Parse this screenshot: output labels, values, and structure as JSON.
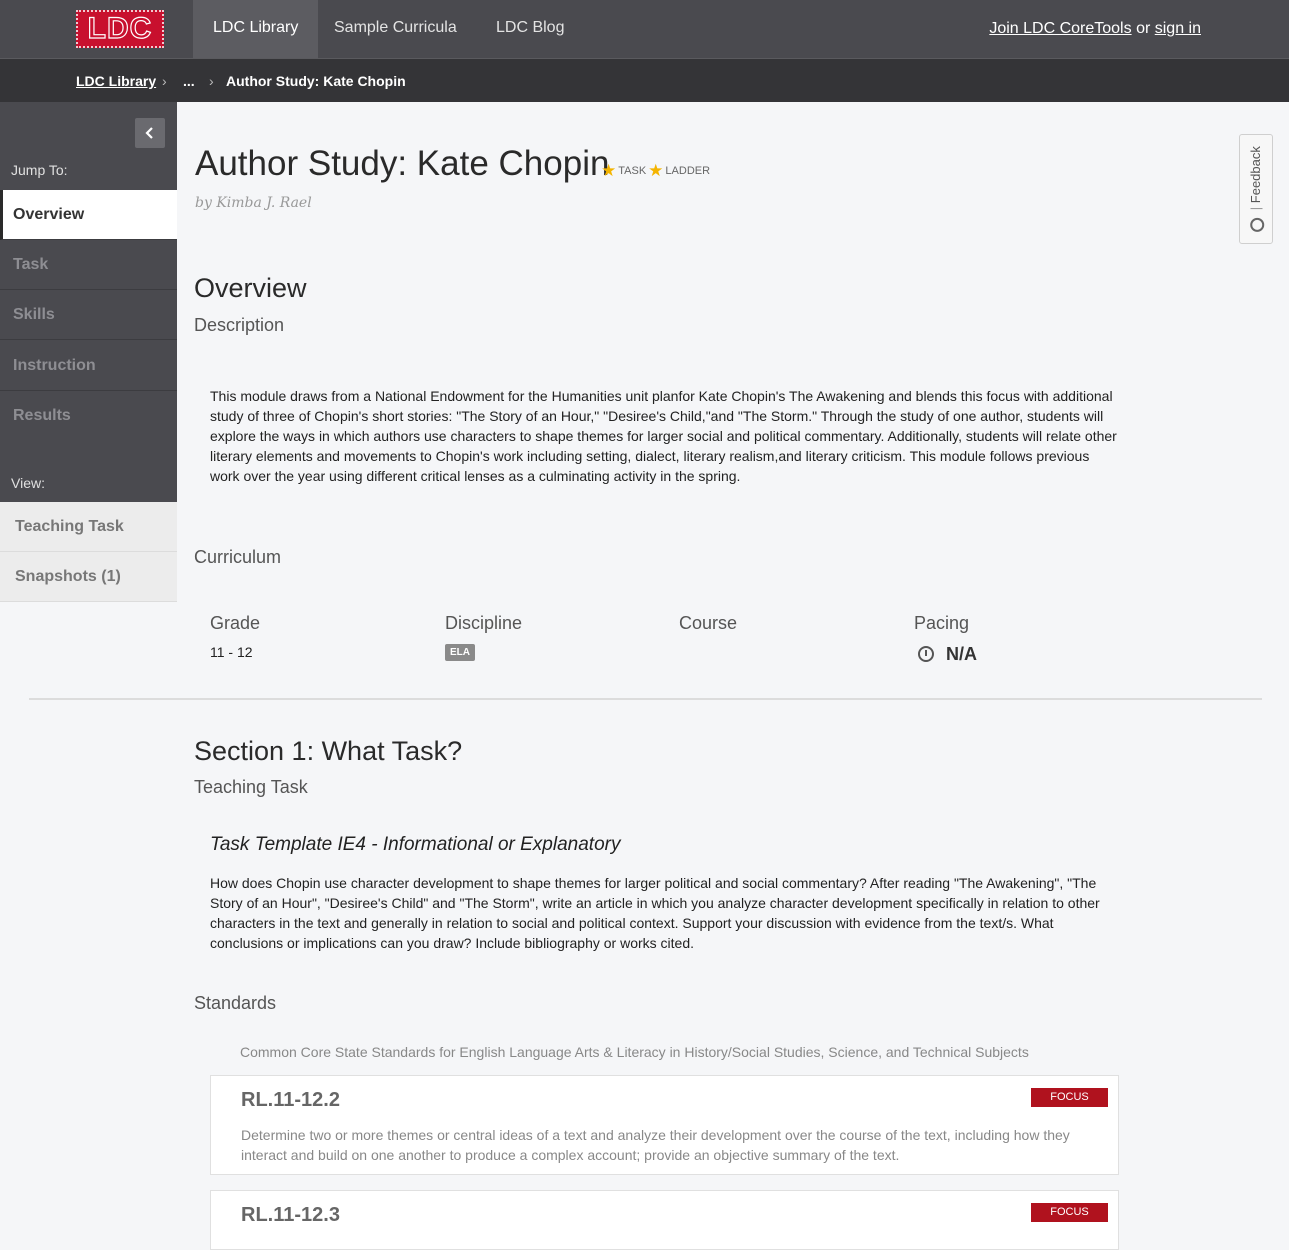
{
  "header": {
    "logo_text": "LDC",
    "nav": [
      "LDC Library",
      "Sample Curricula",
      "LDC Blog"
    ],
    "auth": {
      "join": "Join LDC CoreTools",
      "or": "or",
      "signin": "sign in"
    }
  },
  "breadcrumb": {
    "root": "LDC Library",
    "ellipsis": "...",
    "current": "Author Study: Kate Chopin",
    "sep": "›"
  },
  "sidebar": {
    "jump_label": "Jump To:",
    "items": [
      "Overview",
      "Task",
      "Skills",
      "Instruction",
      "Results"
    ],
    "view_label": "View:",
    "view_items": [
      "Teaching Task",
      "Snapshots (1)"
    ]
  },
  "feedback": {
    "label": "Feedback"
  },
  "page": {
    "title": "Author Study: Kate Chopin",
    "badges": [
      "TASK",
      "LADDER"
    ],
    "byline": "by Kimba J. Rael"
  },
  "overview": {
    "heading": "Overview",
    "description_heading": "Description",
    "description": "This module draws from a National Endowment for the Humanities unit planfor Kate Chopin's The Awakening and blends this focus with additional study of three of Chopin's short stories: \"The Story of an Hour,\" \"Desiree's Child,\"and \"The Storm.\" Through the study of one author, students will explore the ways in which authors use characters to shape themes for larger social and political commentary. Additionally, students will relate other literary elements and movements to Chopin's work including setting, dialect, literary realism,and literary criticism. This module follows previous work over the year using different critical lenses as a culminating activity in the spring.",
    "curriculum_heading": "Curriculum",
    "columns": {
      "grade_label": "Grade",
      "grade_value": "11 - 12",
      "discipline_label": "Discipline",
      "discipline_value": "ELA",
      "course_label": "Course",
      "pacing_label": "Pacing",
      "pacing_value": "N/A"
    }
  },
  "section1": {
    "heading": "Section 1: What Task?",
    "subheading": "Teaching Task",
    "template_title": "Task Template IE4 - Informational or Explanatory",
    "prompt": "How does Chopin use character development to shape themes for larger political and social commentary? After reading \"The Awakening\", \"The Story of an Hour\", \"Desiree's Child\" and \"The Storm\", write an article in which you analyze character development specifically in relation to other characters in the text and generally in relation to social and political context. Support your discussion with evidence from the text/s. What conclusions or implications can you draw? Include bibliography or works cited.",
    "standards_heading": "Standards",
    "standards_source": "Common Core State Standards for English Language Arts & Literacy in History/Social Studies, Science, and Technical Subjects",
    "standards": [
      {
        "code": "RL.11-12.2",
        "badge": "FOCUS",
        "description": "Determine two or more themes or central ideas of a text and analyze their development over the course of the text, including how they interact and build on one another to produce a complex account; provide an objective summary of the text."
      },
      {
        "code": "RL.11-12.3",
        "badge": "FOCUS",
        "description": ""
      }
    ]
  }
}
